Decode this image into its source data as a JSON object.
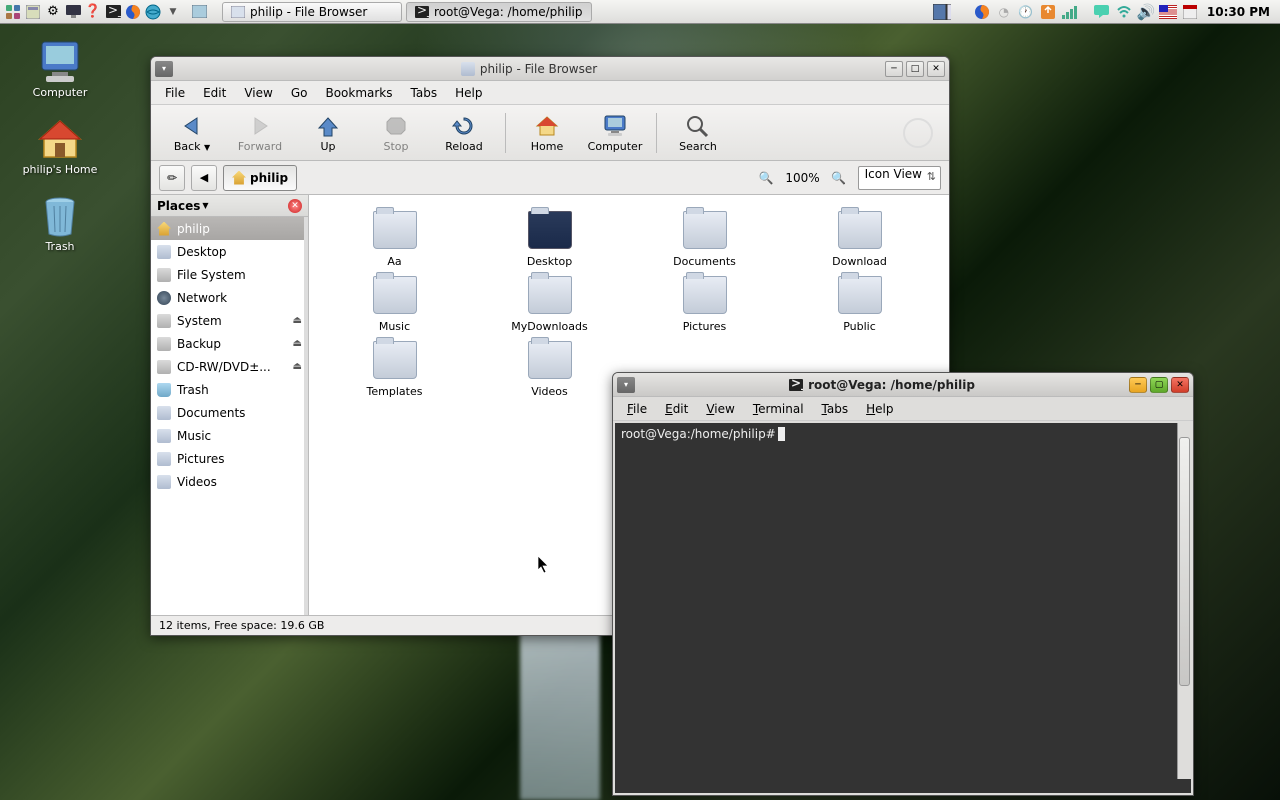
{
  "panel": {
    "taskbar": [
      {
        "label": "philip - File Browser",
        "active": false
      },
      {
        "label": "root@Vega: /home/philip",
        "active": true
      }
    ],
    "clock": "10:30 PM"
  },
  "desktop": {
    "icons": [
      {
        "name": "computer",
        "label": "Computer"
      },
      {
        "name": "home",
        "label": "philip's Home"
      },
      {
        "name": "trash",
        "label": "Trash"
      }
    ]
  },
  "file_browser": {
    "title": "philip - File Browser",
    "menus": [
      "File",
      "Edit",
      "View",
      "Go",
      "Bookmarks",
      "Tabs",
      "Help"
    ],
    "toolbar": [
      {
        "name": "back",
        "label": "Back",
        "disabled": false
      },
      {
        "name": "forward",
        "label": "Forward",
        "disabled": true
      },
      {
        "name": "up",
        "label": "Up",
        "disabled": false
      },
      {
        "name": "stop",
        "label": "Stop",
        "disabled": true
      },
      {
        "name": "reload",
        "label": "Reload",
        "disabled": false
      },
      {
        "name": "home",
        "label": "Home",
        "disabled": false
      },
      {
        "name": "computer",
        "label": "Computer",
        "disabled": false
      },
      {
        "name": "search",
        "label": "Search",
        "disabled": false
      }
    ],
    "location": {
      "current": "philip"
    },
    "zoom": "100%",
    "view_mode": "Icon View",
    "sidebar": {
      "header": "Places",
      "items": [
        {
          "label": "philip",
          "icon": "home",
          "selected": true
        },
        {
          "label": "Desktop",
          "icon": "desktop"
        },
        {
          "label": "File System",
          "icon": "drive"
        },
        {
          "label": "Network",
          "icon": "globe"
        },
        {
          "label": "System",
          "icon": "drive",
          "eject": true
        },
        {
          "label": "Backup",
          "icon": "drive",
          "eject": true
        },
        {
          "label": "CD-RW/DVD±...",
          "icon": "disc",
          "eject": true
        },
        {
          "label": "Trash",
          "icon": "trash"
        },
        {
          "label": "Documents",
          "icon": "folder"
        },
        {
          "label": "Music",
          "icon": "folder"
        },
        {
          "label": "Pictures",
          "icon": "folder"
        },
        {
          "label": "Videos",
          "icon": "folder"
        }
      ]
    },
    "files": [
      {
        "name": "Aa",
        "type": "folder"
      },
      {
        "name": "Desktop",
        "type": "desktop"
      },
      {
        "name": "Documents",
        "type": "folder"
      },
      {
        "name": "Download",
        "type": "folder"
      },
      {
        "name": "Music",
        "type": "folder"
      },
      {
        "name": "MyDownloads",
        "type": "folder"
      },
      {
        "name": "Pictures",
        "type": "folder"
      },
      {
        "name": "Public",
        "type": "folder"
      },
      {
        "name": "Templates",
        "type": "folder"
      },
      {
        "name": "Videos",
        "type": "folder"
      }
    ],
    "status": "12 items, Free space: 19.6 GB"
  },
  "terminal": {
    "title": "root@Vega: /home/philip",
    "menus": [
      "File",
      "Edit",
      "View",
      "Terminal",
      "Tabs",
      "Help"
    ],
    "prompt": "root@Vega:/home/philip#"
  }
}
